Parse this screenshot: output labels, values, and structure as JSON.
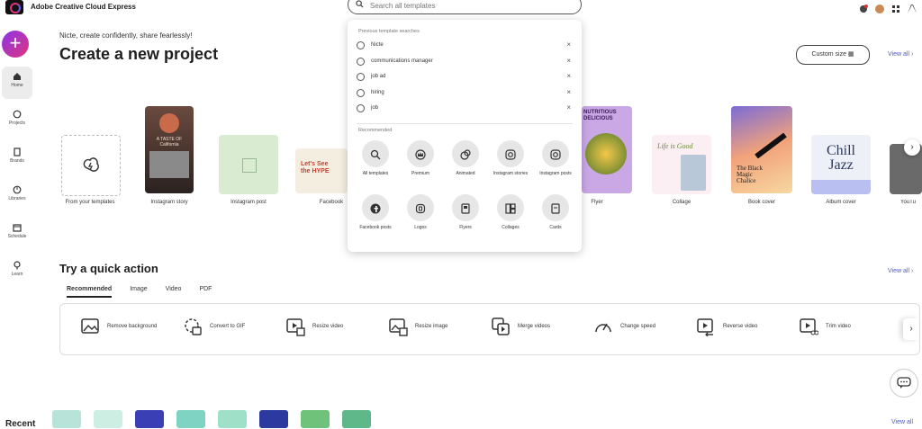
{
  "app": {
    "title": "Adobe Creative Cloud Express"
  },
  "search": {
    "placeholder": "Search all templates"
  },
  "sidebar": {
    "items": [
      {
        "label": "Home",
        "icon": "home-icon"
      },
      {
        "label": "Projects",
        "icon": "projects-icon"
      },
      {
        "label": "Brands",
        "icon": "brands-icon"
      },
      {
        "label": "Libraries",
        "icon": "libraries-icon"
      },
      {
        "label": "Schedule",
        "icon": "schedule-icon"
      },
      {
        "label": "Learn",
        "icon": "learn-icon"
      }
    ]
  },
  "main": {
    "greeting": "Nicte, create confidently, share fearlessly!",
    "title": "Create a new project",
    "custom_size": "Custom size",
    "view_all": "View all"
  },
  "cards": [
    {
      "label": "From your templates"
    },
    {
      "label": "Instagram story"
    },
    {
      "label": "Instagram post"
    },
    {
      "label": "Facebook"
    },
    {
      "label": "Flyer"
    },
    {
      "label": "Collage"
    },
    {
      "label": "Book cover"
    },
    {
      "label": "Album cover"
    },
    {
      "label": "YouTu"
    }
  ],
  "card_art": {
    "story_title": "A TASTE OF California",
    "facebook_title": "Let's See the HYPE",
    "flyer_title": "NUTRITIOUS DELICIOUS",
    "collage_title": "Life is Good",
    "book_title": "The Black Magic Chalice",
    "album_title": "Chill Jazz"
  },
  "dropdown": {
    "previous_header": "Previous template searches",
    "previous": [
      "Nicte",
      "communications manager",
      "job ad",
      "hiring",
      "job"
    ],
    "recommended_header": "Recommended",
    "recommended": [
      {
        "label": "All templates",
        "icon": "all-templates-icon"
      },
      {
        "label": "Premium",
        "icon": "premium-crown-icon"
      },
      {
        "label": "Animated",
        "icon": "animated-icon"
      },
      {
        "label": "Instagram stories",
        "icon": "instagram-icon"
      },
      {
        "label": "Instagram posts",
        "icon": "instagram-icon"
      },
      {
        "label": "Facebook posts",
        "icon": "facebook-icon"
      },
      {
        "label": "Logos",
        "icon": "logo-icon"
      },
      {
        "label": "Flyers",
        "icon": "flyer-icon"
      },
      {
        "label": "Collages",
        "icon": "collage-icon"
      },
      {
        "label": "Cards",
        "icon": "card-icon"
      }
    ]
  },
  "quick": {
    "title": "Try a quick action",
    "view_all": "View all",
    "tabs": [
      "Recommended",
      "Image",
      "Video",
      "PDF"
    ],
    "actions": [
      {
        "label": "Remove background",
        "icon": "remove-background-icon"
      },
      {
        "label": "Convert to GIF",
        "icon": "convert-gif-icon"
      },
      {
        "label": "Resize video",
        "icon": "resize-video-icon"
      },
      {
        "label": "Resize image",
        "icon": "resize-image-icon"
      },
      {
        "label": "Merge videos",
        "icon": "merge-videos-icon"
      },
      {
        "label": "Change speed",
        "icon": "change-speed-icon"
      },
      {
        "label": "Reverse video",
        "icon": "reverse-video-icon"
      },
      {
        "label": "Trim video",
        "icon": "trim-video-icon"
      }
    ]
  },
  "recent": {
    "title": "Recent",
    "view_all": "View all"
  },
  "colors": {
    "accent": "#4b5bd4",
    "create_button": "#b33ae0"
  }
}
